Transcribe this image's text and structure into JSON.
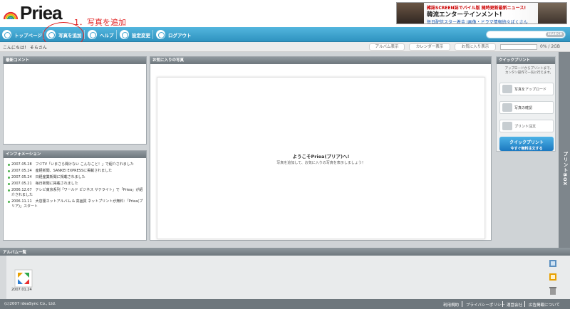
{
  "header": {
    "logo": "Priea",
    "annotation": "1．写真を追加",
    "banner": {
      "line1": "雑誌SCREEN誌でバイル版 随時更新最新ニュース!",
      "line2": "韓流エンターテインメント!",
      "line3": "毎日配信スター着金 I画像・ドラマ情報続々ばくさん"
    }
  },
  "nav": {
    "items": [
      {
        "label": "トップページ"
      },
      {
        "label": "写真を追加"
      },
      {
        "label": "ヘルプ"
      },
      {
        "label": "設定変更"
      },
      {
        "label": "ログアウト"
      }
    ],
    "search_label": "SEARCH"
  },
  "greeting": {
    "text": "こんにちは！ そらさん",
    "buttons": [
      "アルバム表示",
      "カレンダー表示",
      "お気に入り表示"
    ],
    "storage": "0% / 2GB"
  },
  "comments": {
    "title": "最新コメント"
  },
  "information": {
    "title": "インフォメーション",
    "items": [
      "2007.05.28　フジTV「いまさら聞けない こんなこと！」で紹介されました",
      "2007.05.24　産経新聞、SANKEI EXPRESSに掲載されました",
      "2007.05.24　日経産業新聞に掲載されました",
      "2007.05.21　毎日新聞に掲載されました",
      "2006.12.07　テレビ東京系列「ワールド ビジネス サテライト」で「Priea」が紹介されました",
      "2006.11.11　大容量ネットアルバム & 高画質 ネットプリントが無料：「Priea(プリア)」スタート"
    ]
  },
  "favorites": {
    "title": "お気に入りの写真",
    "welcome": "ようこそPriea(プリア)へ!",
    "sub": "写真を追加して、お気に入りの写真を表示しましょう！"
  },
  "quick_print": {
    "title": "クイックプリント",
    "desc1": "アップロードからプリントまで、",
    "desc2": "カンタン操作で一気に行えます。",
    "steps": [
      "写真をアップロード",
      "写真の確認",
      "プリント注文"
    ],
    "quick_title": "クイックプリント",
    "quick_sub": "今すぐ無料注文する"
  },
  "side_tab": "プリントBOX",
  "album": {
    "title": "アルバム一覧",
    "items": [
      {
        "date": "2007.01.24"
      }
    ]
  },
  "footer": {
    "copyright": "(c)2007 ideaSync Co., Ltd.",
    "links": [
      "利用規約",
      "プライバシーポリシー",
      "運営会社",
      "広告掲載について"
    ]
  }
}
